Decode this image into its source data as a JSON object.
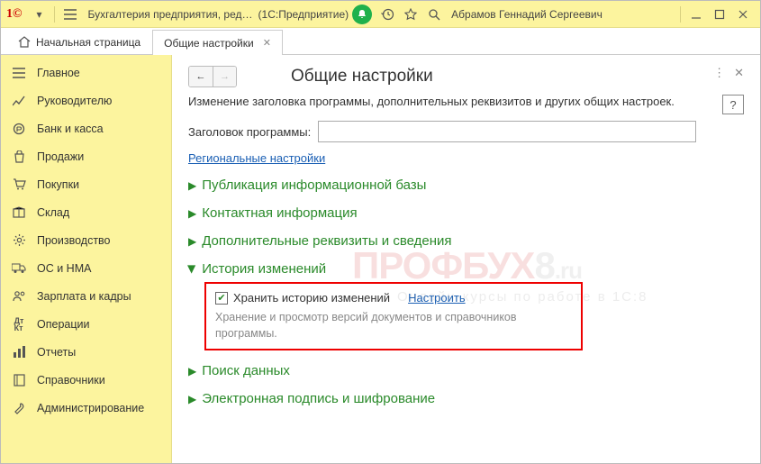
{
  "title_bar": {
    "app_title": "Бухгалтерия предприятия, ред…",
    "platform": "(1С:Предприятие)",
    "user": "Абрамов Геннадий Сергеевич"
  },
  "tabs": {
    "home": "Начальная страница",
    "active": "Общие настройки"
  },
  "sidebar": {
    "items": [
      {
        "label": "Главное",
        "icon": "star"
      },
      {
        "label": "Руководителю",
        "icon": "trend"
      },
      {
        "label": "Банк и касса",
        "icon": "coin"
      },
      {
        "label": "Продажи",
        "icon": "bag"
      },
      {
        "label": "Покупки",
        "icon": "cart"
      },
      {
        "label": "Склад",
        "icon": "box"
      },
      {
        "label": "Производство",
        "icon": "gear"
      },
      {
        "label": "ОС и НМА",
        "icon": "truck"
      },
      {
        "label": "Зарплата и кадры",
        "icon": "people"
      },
      {
        "label": "Операции",
        "icon": "dtkt"
      },
      {
        "label": "Отчеты",
        "icon": "bars"
      },
      {
        "label": "Справочники",
        "icon": "book"
      },
      {
        "label": "Администрирование",
        "icon": "wrench"
      }
    ]
  },
  "content": {
    "title": "Общие настройки",
    "desc": "Изменение заголовка программы, дополнительных реквизитов и других общих настроек.",
    "field_label": "Заголовок программы:",
    "regional_link": "Региональные настройки",
    "sections": {
      "pub": "Публикация информационной базы",
      "contact": "Контактная информация",
      "extra": "Дополнительные реквизиты и сведения",
      "history": "История изменений",
      "search": "Поиск данных",
      "sign": "Электронная подпись и шифрование"
    },
    "history_box": {
      "chk_label": "Хранить историю изменений",
      "configure": "Настроить",
      "desc": "Хранение и просмотр версий документов и справочников программы."
    }
  },
  "watermark": {
    "p1": "ПРОФБУХ",
    "p2": "8",
    "p3": ".ru",
    "sub": "Онлайн-курсы по работе в 1С:8"
  }
}
